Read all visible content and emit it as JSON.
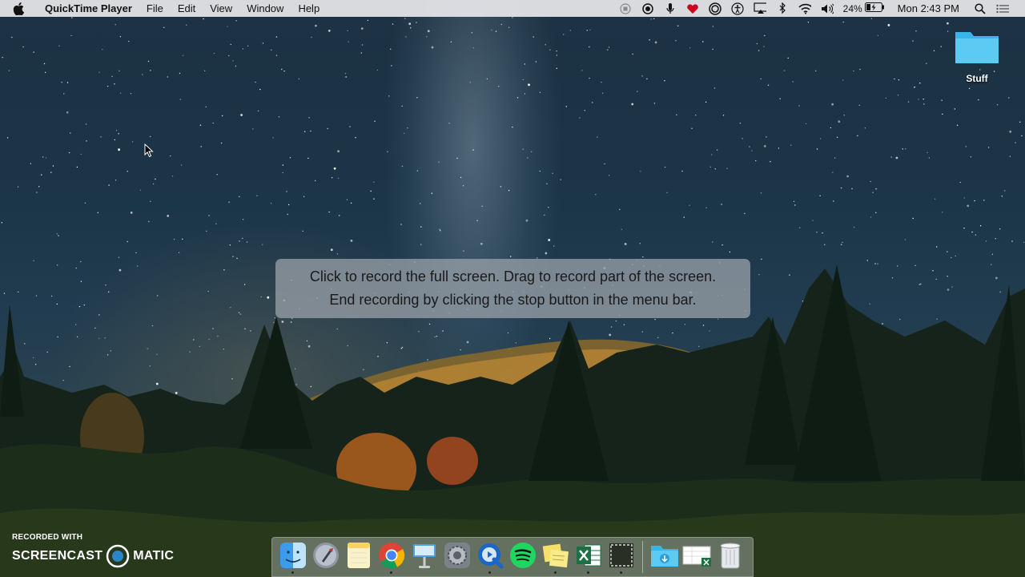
{
  "menubar": {
    "apple_icon": "apple-icon",
    "app_name": "QuickTime Player",
    "menus": [
      "File",
      "Edit",
      "View",
      "Window",
      "Help"
    ],
    "status_icons": [
      "record-stop-icon",
      "screen-record-icon",
      "microphone-icon",
      "lastpass-icon",
      "screenflick-icon",
      "accessibility-icon",
      "airplay-icon",
      "bluetooth-icon",
      "wifi-icon",
      "volume-icon"
    ],
    "battery_percent": "24%",
    "clock": "Mon 2:43 PM",
    "spotlight_icon": "search-icon",
    "notification_icon": "list-icon"
  },
  "desktop": {
    "folder_label": "Stuff",
    "folder_color": "#4fc3f7"
  },
  "hud": {
    "line1": "Click to record the full screen. Drag to record part of the screen.",
    "line2": "End recording by clicking the stop button in the menu bar."
  },
  "watermark": {
    "small": "RECORDED WITH",
    "brand_left": "SCREENCAST",
    "brand_right": "MATIC"
  },
  "dock": {
    "apps": [
      {
        "name": "Finder",
        "icon": "finder-icon",
        "running": true
      },
      {
        "name": "Launchpad",
        "icon": "rocket-icon",
        "running": false
      },
      {
        "name": "Notes",
        "icon": "notes-icon",
        "running": false
      },
      {
        "name": "Google Chrome",
        "icon": "chrome-icon",
        "running": true
      },
      {
        "name": "Keynote",
        "icon": "keynote-icon",
        "running": false
      },
      {
        "name": "System Preferences",
        "icon": "gear-icon",
        "running": false
      },
      {
        "name": "QuickTime Player",
        "icon": "quicktime-icon",
        "running": true
      },
      {
        "name": "Spotify",
        "icon": "spotify-icon",
        "running": false
      },
      {
        "name": "Stickies",
        "icon": "stickies-icon",
        "running": true
      },
      {
        "name": "Microsoft Excel",
        "icon": "excel-icon",
        "running": true
      },
      {
        "name": "Screenshot",
        "icon": "screenshot-icon",
        "running": true
      }
    ],
    "stack_items": [
      {
        "name": "Downloads",
        "icon": "downloads-folder-icon"
      },
      {
        "name": "Excel document",
        "icon": "excel-document-icon"
      },
      {
        "name": "Trash",
        "icon": "trash-icon"
      }
    ]
  }
}
